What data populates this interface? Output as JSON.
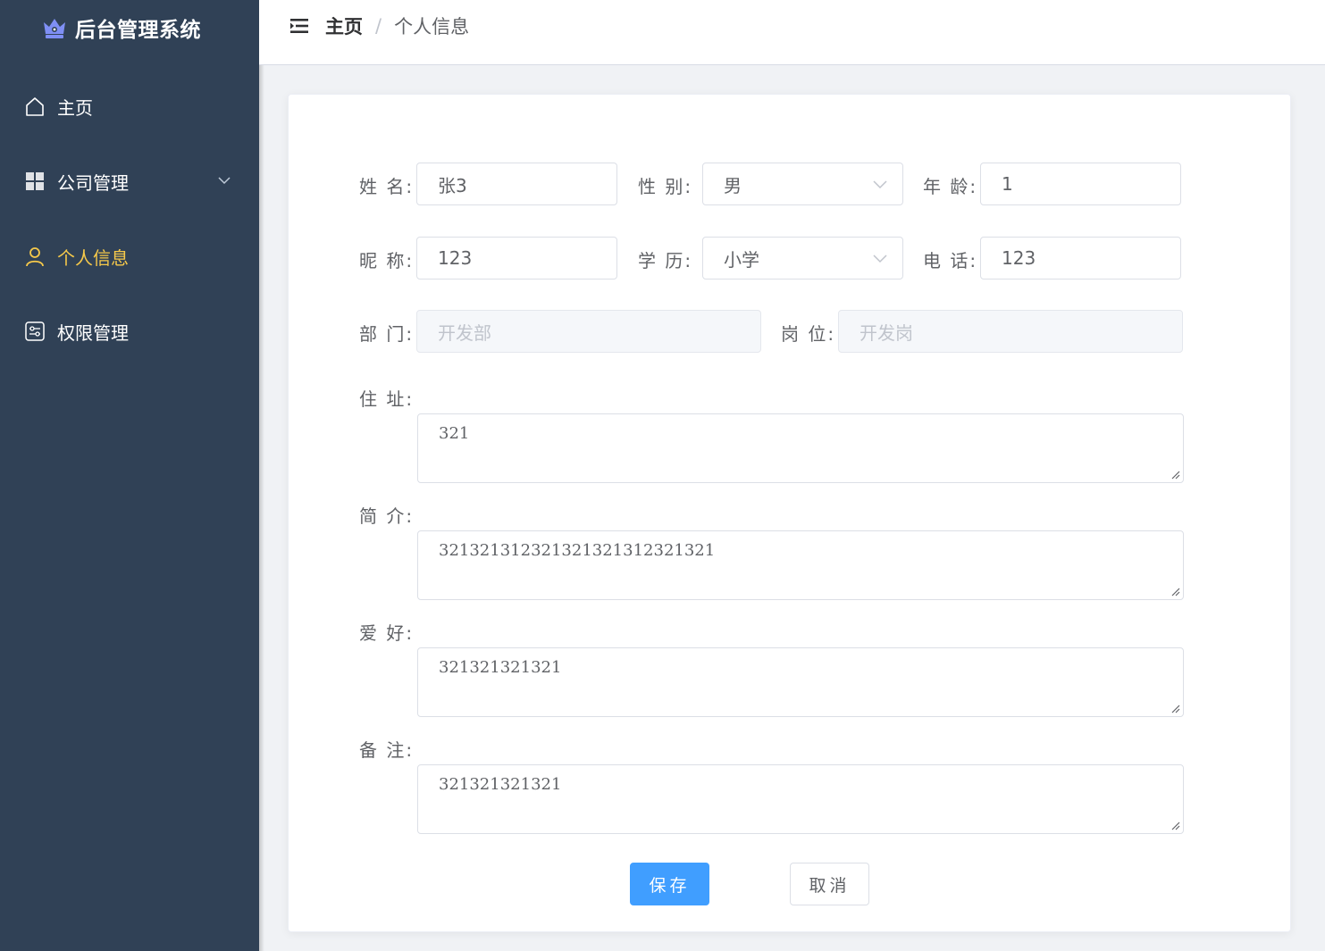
{
  "app": {
    "title": "后台管理系统"
  },
  "sidebar": {
    "items": [
      {
        "label": "主页",
        "icon": "home-icon"
      },
      {
        "label": "公司管理",
        "icon": "grid-icon"
      },
      {
        "label": "个人信息",
        "icon": "user-icon",
        "active": true
      },
      {
        "label": "权限管理",
        "icon": "permission-icon"
      }
    ]
  },
  "breadcrumb": {
    "home": "主页",
    "separator": "/",
    "current": "个人信息"
  },
  "form": {
    "name": {
      "label": "姓 名:",
      "value": "张3"
    },
    "gender": {
      "label": "性 别:",
      "value": "男"
    },
    "age": {
      "label": "年 龄:",
      "value": "1"
    },
    "nickname": {
      "label": "昵 称:",
      "value": "123"
    },
    "education": {
      "label": "学 历:",
      "value": "小学"
    },
    "phone": {
      "label": "电 话:",
      "value": "123"
    },
    "department": {
      "label": "部 门:",
      "placeholder": "开发部"
    },
    "position": {
      "label": "岗 位:",
      "placeholder": "开发岗"
    },
    "address": {
      "label": "住 址:",
      "value": "321"
    },
    "intro": {
      "label": "简 介:",
      "value": "32132131232132132131232132​1"
    },
    "hobby": {
      "label": "爱 好:",
      "value": "321321321321"
    },
    "remark": {
      "label": "备 注:",
      "value": "321321321321"
    }
  },
  "buttons": {
    "save": "保存",
    "cancel": "取消"
  },
  "colors": {
    "sidebar_bg": "#304156",
    "active": "#f6c94a",
    "primary": "#409eff"
  }
}
